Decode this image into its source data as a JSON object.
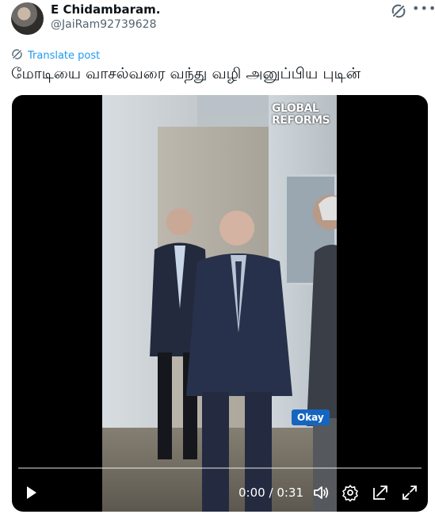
{
  "author": {
    "display_name": "E Chidambaram.",
    "handle": "@JaiRam92739628"
  },
  "header_icons": [
    "grok-icon",
    "more-icon"
  ],
  "translate_label": "Translate post",
  "post_text": "மோடியை வாசல்வரை வந்து வழி அனுப்பிய புடின்",
  "video": {
    "watermark_line1": "GLOBAL",
    "watermark_line2": "REFORMS",
    "caption": "Okay",
    "current_time": "0:00",
    "time_separator": "/",
    "duration": "0:31",
    "progress_fraction": 0.0,
    "controls": [
      "play-icon",
      "volume-icon",
      "settings-icon",
      "pip-icon",
      "fullscreen-icon"
    ]
  },
  "colors": {
    "accent": "#1d9bf0",
    "text": "#0f1419",
    "secondary_text": "#536471",
    "caption_bg": "#1565c0"
  }
}
